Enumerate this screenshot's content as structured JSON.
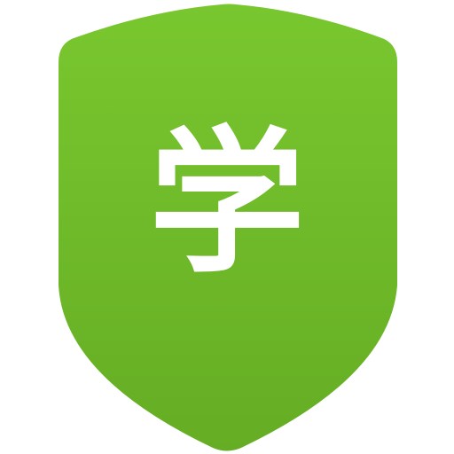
{
  "icon": {
    "name": "shield-icon",
    "glyph": "学",
    "colors": {
      "gradient_top": "#79c72f",
      "gradient_bottom": "#65ad24",
      "glyph": "#ffffff"
    }
  }
}
